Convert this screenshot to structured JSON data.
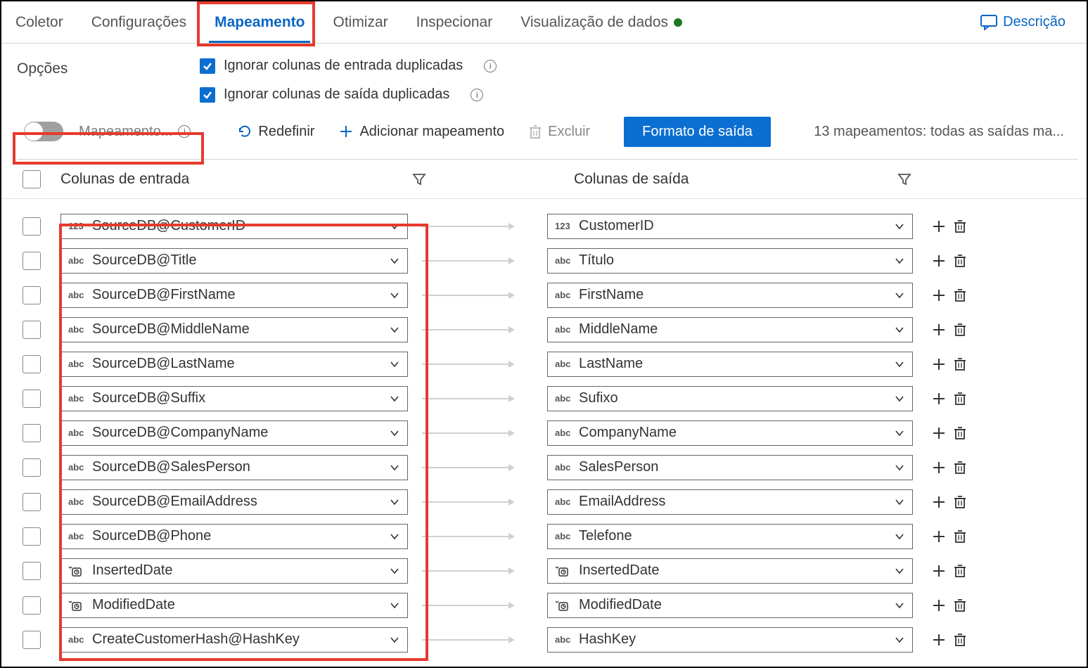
{
  "tabs": {
    "coletor": "Coletor",
    "configuracoes": "Configurações",
    "mapeamento": "Mapeamento",
    "otimizar": "Otimizar",
    "inspecionar": "Inspecionar",
    "visualizacao": "Visualização de dados"
  },
  "descricao_label": "Descrição",
  "options_label": "Opções",
  "skip_dup_input": "Ignorar colunas de entrada duplicadas",
  "skip_dup_output": "Ignorar colunas de saída duplicadas",
  "mapeamento_toggle": "Mapeamento...",
  "btn_reset": "Redefinir",
  "btn_add_mapping": "Adicionar mapeamento",
  "btn_delete": "Excluir",
  "btn_output_format": "Formato de saída",
  "summary": "13 mapeamentos: todas as saídas ma...",
  "th_input": "Colunas de entrada",
  "th_output": "Colunas de saída",
  "types": {
    "int": "123",
    "str": "abc"
  },
  "rows": [
    {
      "in_type": "int",
      "in": "SourceDB@CustomerID",
      "out_type": "int",
      "out": "CustomerID"
    },
    {
      "in_type": "str",
      "in": "SourceDB@Title",
      "out_type": "str",
      "out": "Título"
    },
    {
      "in_type": "str",
      "in": "SourceDB@FirstName",
      "out_type": "str",
      "out": "FirstName"
    },
    {
      "in_type": "str",
      "in": "SourceDB@MiddleName",
      "out_type": "str",
      "out": "MiddleName"
    },
    {
      "in_type": "str",
      "in": "SourceDB@LastName",
      "out_type": "str",
      "out": "LastName"
    },
    {
      "in_type": "str",
      "in": "SourceDB@Suffix",
      "out_type": "str",
      "out": "Sufixo"
    },
    {
      "in_type": "str",
      "in": "SourceDB@CompanyName",
      "out_type": "str",
      "out": "CompanyName"
    },
    {
      "in_type": "str",
      "in": "SourceDB@SalesPerson",
      "out_type": "str",
      "out": "SalesPerson"
    },
    {
      "in_type": "str",
      "in": "SourceDB@EmailAddress",
      "out_type": "str",
      "out": "EmailAddress"
    },
    {
      "in_type": "str",
      "in": "SourceDB@Phone",
      "out_type": "str",
      "out": "Telefone"
    },
    {
      "in_type": "clock",
      "in": "InsertedDate",
      "out_type": "clock",
      "out": "InsertedDate"
    },
    {
      "in_type": "clock",
      "in": "ModifiedDate",
      "out_type": "clock",
      "out": "ModifiedDate"
    },
    {
      "in_type": "str",
      "in": "CreateCustomerHash@HashKey",
      "out_type": "str",
      "out": "HashKey"
    }
  ]
}
